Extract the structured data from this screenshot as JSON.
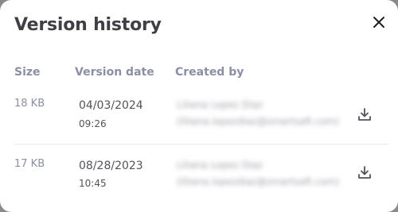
{
  "dialog": {
    "title": "Version history",
    "close_icon": "close-icon"
  },
  "table": {
    "headers": {
      "size": "Size",
      "version_date": "Version date",
      "created_by": "Created by"
    },
    "rows": [
      {
        "size": "18 KB",
        "date": "04/03/2024",
        "time": "09:26",
        "creator_name": "Liliana Lopez Diaz",
        "creator_email": "(liliana.lopezdiaz@smartsaft.com)",
        "download_icon": "download-icon"
      },
      {
        "size": "17 KB",
        "date": "08/28/2023",
        "time": "10:45",
        "creator_name": "Liliana Lopez Diaz",
        "creator_email": "(liliana.lopezdiaz@smartsaft.com)",
        "download_icon": "download-icon"
      }
    ]
  },
  "colors": {
    "title": "#3f3f46",
    "header_text": "#8b8fa3",
    "body_text": "#52525b",
    "icon": "#52525b",
    "divider": "#ebebef"
  }
}
